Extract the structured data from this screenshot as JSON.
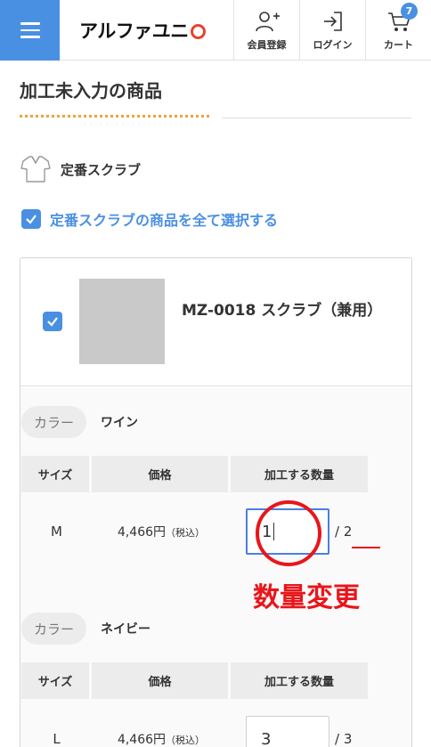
{
  "header": {
    "logo_text": "アルファユニ",
    "buttons": [
      {
        "label": "会員登録",
        "icon": "user-plus-icon"
      },
      {
        "label": "ログイン",
        "icon": "login-icon"
      },
      {
        "label": "カート",
        "icon": "cart-icon",
        "badge": "7"
      }
    ]
  },
  "page": {
    "title": "加工未入力の商品"
  },
  "category": {
    "label": "定番スクラブ",
    "select_all_label": "定番スクラブの商品を全て選択する",
    "select_all_checked": true
  },
  "product": {
    "name": "MZ-0018 スクラブ（兼用）",
    "checked": true,
    "table_headers": {
      "size": "サイズ",
      "price": "価格",
      "qty": "加工する数量"
    },
    "colors": [
      {
        "color_label": "カラー",
        "color_value": "ワイン",
        "rows": [
          {
            "size": "M",
            "price": "4,466円",
            "tax": "（税込）",
            "qty": "1",
            "max": "/ 2"
          }
        ]
      },
      {
        "color_label": "カラー",
        "color_value": "ネイビー",
        "rows": [
          {
            "size": "L",
            "price": "4,466円",
            "tax": "（税込）",
            "qty": "3",
            "max": "/ 3"
          }
        ]
      }
    ]
  },
  "annotation": {
    "text": "数量変更",
    "color": "#e8161b"
  },
  "colors": {
    "accent": "#4a90e2",
    "title_dots": "#f0a23a"
  }
}
